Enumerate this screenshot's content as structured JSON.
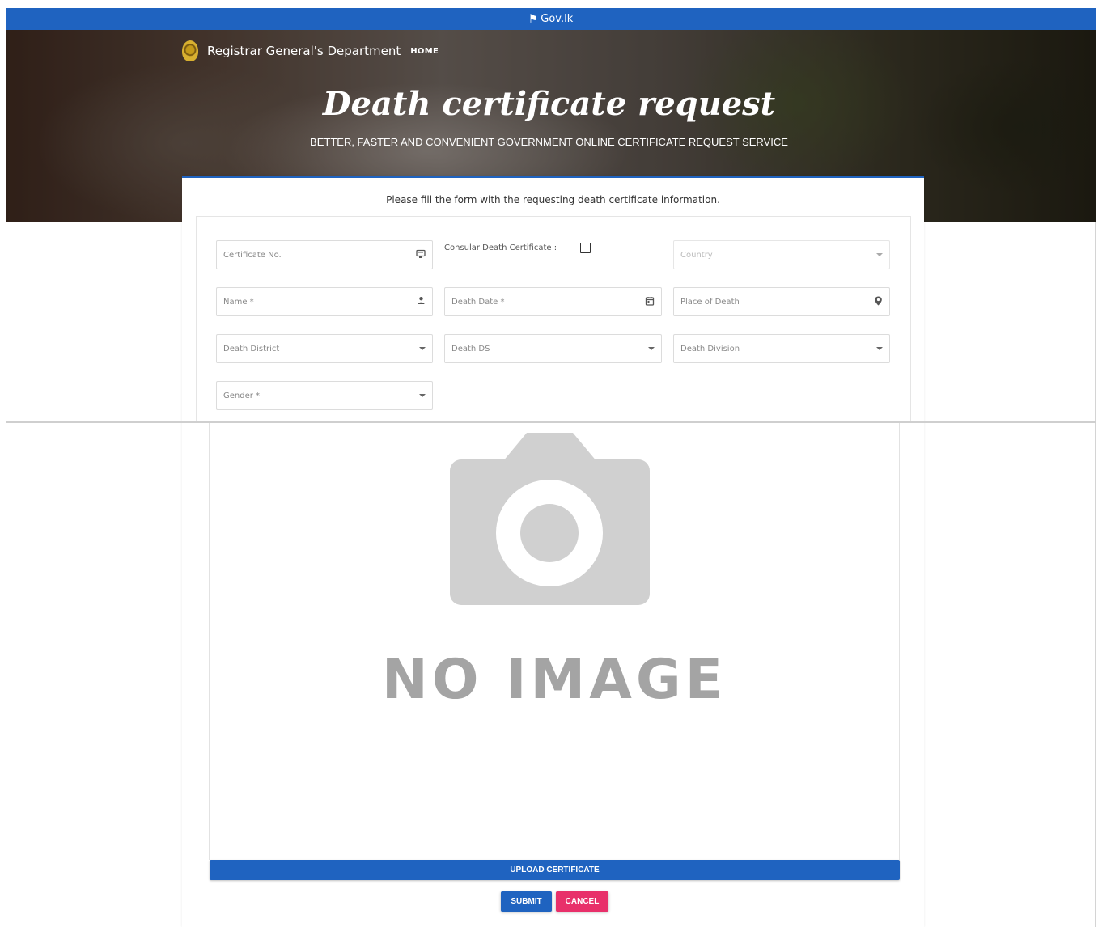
{
  "gov_bar": {
    "label": "Gov.lk"
  },
  "header": {
    "department": "Registrar General's Department",
    "home": "HOME"
  },
  "hero": {
    "title": "Death certificate request",
    "subtitle": "BETTER, FASTER AND CONVENIENT GOVERNMENT ONLINE CERTIFICATE REQUEST SERVICE"
  },
  "form": {
    "intro": "Please fill the form with the requesting death certificate information.",
    "certificate_no": {
      "placeholder": "Certificate No.",
      "icon": "certificate-icon"
    },
    "consular": {
      "label": "Consular Death Certificate :",
      "checked": false
    },
    "country": {
      "placeholder": "Country",
      "disabled": true
    },
    "name": {
      "placeholder": "Name *",
      "icon": "person-icon"
    },
    "death_date": {
      "placeholder": "Death Date *",
      "icon": "calendar-icon"
    },
    "place_of_death": {
      "placeholder": "Place of Death",
      "icon": "location-pin-icon"
    },
    "death_district": {
      "placeholder": "Death District"
    },
    "death_ds": {
      "placeholder": "Death DS"
    },
    "death_division": {
      "placeholder": "Death Division"
    },
    "gender": {
      "placeholder": "Gender *"
    }
  },
  "image_preview": {
    "text": "NO IMAGE"
  },
  "buttons": {
    "upload": "UPLOAD CERTIFICATE",
    "submit": "SUBMIT",
    "cancel": "CANCEL"
  },
  "colors": {
    "primary": "#1f63c0",
    "danger": "#e8306a",
    "placeholder_graphic": "#d0d0d0"
  }
}
